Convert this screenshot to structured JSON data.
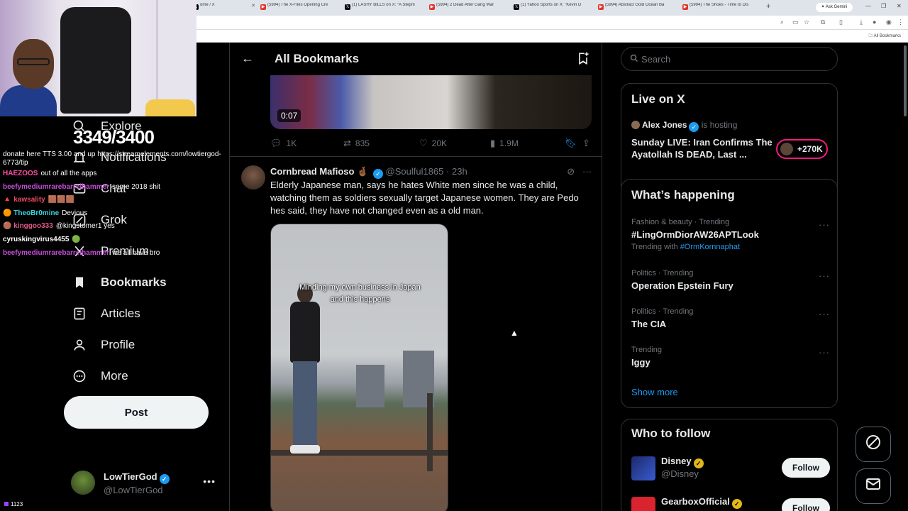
{
  "browser": {
    "tabs": [
      {
        "title": "ome / X",
        "fav": "x"
      },
      {
        "title": "(5994) The X-Files Opening Cre",
        "fav": "yt"
      },
      {
        "title": "(1) LASHY BILLS on X: \"A Stepm",
        "fav": "x"
      },
      {
        "title": "(5994) 2 Dead After Gang War",
        "fav": "yt"
      },
      {
        "title": "(1) Yahoo Sports on X: \"Kevin D",
        "fav": "x"
      },
      {
        "title": "(5994) Abstract Gold Ocean Ba",
        "fav": "yt"
      },
      {
        "title": "(5994) The Shoes - Time to Dis",
        "fav": "yt"
      }
    ],
    "ask_gemini": "Ask Gemini",
    "all_bookmarks": "All Bookmarks"
  },
  "nav": {
    "items": [
      {
        "label": "Explore",
        "icon": "search-icon"
      },
      {
        "label": "Notifications",
        "icon": "bell-icon"
      },
      {
        "label": "Chat",
        "icon": "mail-icon"
      },
      {
        "label": "Grok",
        "icon": "grok-icon"
      },
      {
        "label": "Premium",
        "icon": "x-premium-icon"
      },
      {
        "label": "Bookmarks",
        "icon": "bookmark-icon"
      },
      {
        "label": "Articles",
        "icon": "articles-icon"
      },
      {
        "label": "Profile",
        "icon": "person-icon"
      },
      {
        "label": "More",
        "icon": "more-circle-icon"
      }
    ],
    "post_label": "Post",
    "account": {
      "name": "LowTierGod",
      "handle": "@LowTierGod"
    }
  },
  "header": {
    "title": "All Bookmarks"
  },
  "prev_tweet": {
    "duration": "0:07",
    "replies": "1K",
    "reposts": "835",
    "likes": "20K",
    "views": "1.9M"
  },
  "tweet": {
    "name": "Cornbread Mafioso",
    "handle": "@Soulful1865",
    "time": "23h",
    "text": "Elderly Japanese man, says he hates White men since he was a child, watching them as soldiers sexually target Japanese women. They are Pedo hes said, they have not changed even as a old man.",
    "media_caption_1": "Minding my own business in Japan",
    "media_caption_2": "and this happens"
  },
  "sidebar": {
    "search_placeholder": "Search",
    "live": {
      "heading": "Live on X",
      "host": "Alex Jones",
      "hosting": "is hosting",
      "title": "Sunday LIVE: Iran Confirms The Ayatollah IS DEAD, Last ...",
      "count": "+270K",
      "accent": "#f91880"
    },
    "happening": {
      "heading": "What’s happening",
      "trends": [
        {
          "meta": "Fashion & beauty · Trending",
          "title": "#LingOrmDiorAW26APTLook",
          "with_label": "Trending with",
          "with_tag": "#OrmKornnaphat"
        },
        {
          "meta": "Politics · Trending",
          "title": "Operation Epstein Fury"
        },
        {
          "meta": "Politics · Trending",
          "title": "The CIA"
        },
        {
          "meta": "Trending",
          "title": "Iggy"
        }
      ],
      "show_more": "Show more"
    },
    "who_to_follow": {
      "heading": "Who to follow",
      "accounts": [
        {
          "name": "Disney",
          "handle": "@Disney",
          "button": "Follow"
        },
        {
          "name": "GearboxOfficial",
          "handle": "",
          "button": "Follow"
        }
      ]
    }
  },
  "stream": {
    "goal": "3349/3400",
    "donate": "donate here TTS 3.00 and up https://streamelements.com/lowtiergod-6773/tip",
    "chat": [
      {
        "user": "HAEZOOS",
        "color": "#ff4fa3",
        "msg": "out of all the apps"
      },
      {
        "user": "beefymediumrarebarrelhammer",
        "color": "#c44fd6",
        "msg": "some 2018 shit"
      },
      {
        "user": "kawsality",
        "color": "#e8495e",
        "msg": ""
      },
      {
        "user": "TheoBr0mine",
        "color": "#3ad6e0",
        "msg": "Devious"
      },
      {
        "user": "kinggoo333",
        "color": "#e05a8a",
        "msg": "@kingstomer1 yes"
      },
      {
        "user": "cyruskingvirus4455",
        "color": "#ffffff",
        "msg": ""
      },
      {
        "user": "beefymediumrarebarrelhammer",
        "color": "#c44fd6",
        "msg": "we all have bro"
      }
    ],
    "viewers": "1123"
  }
}
